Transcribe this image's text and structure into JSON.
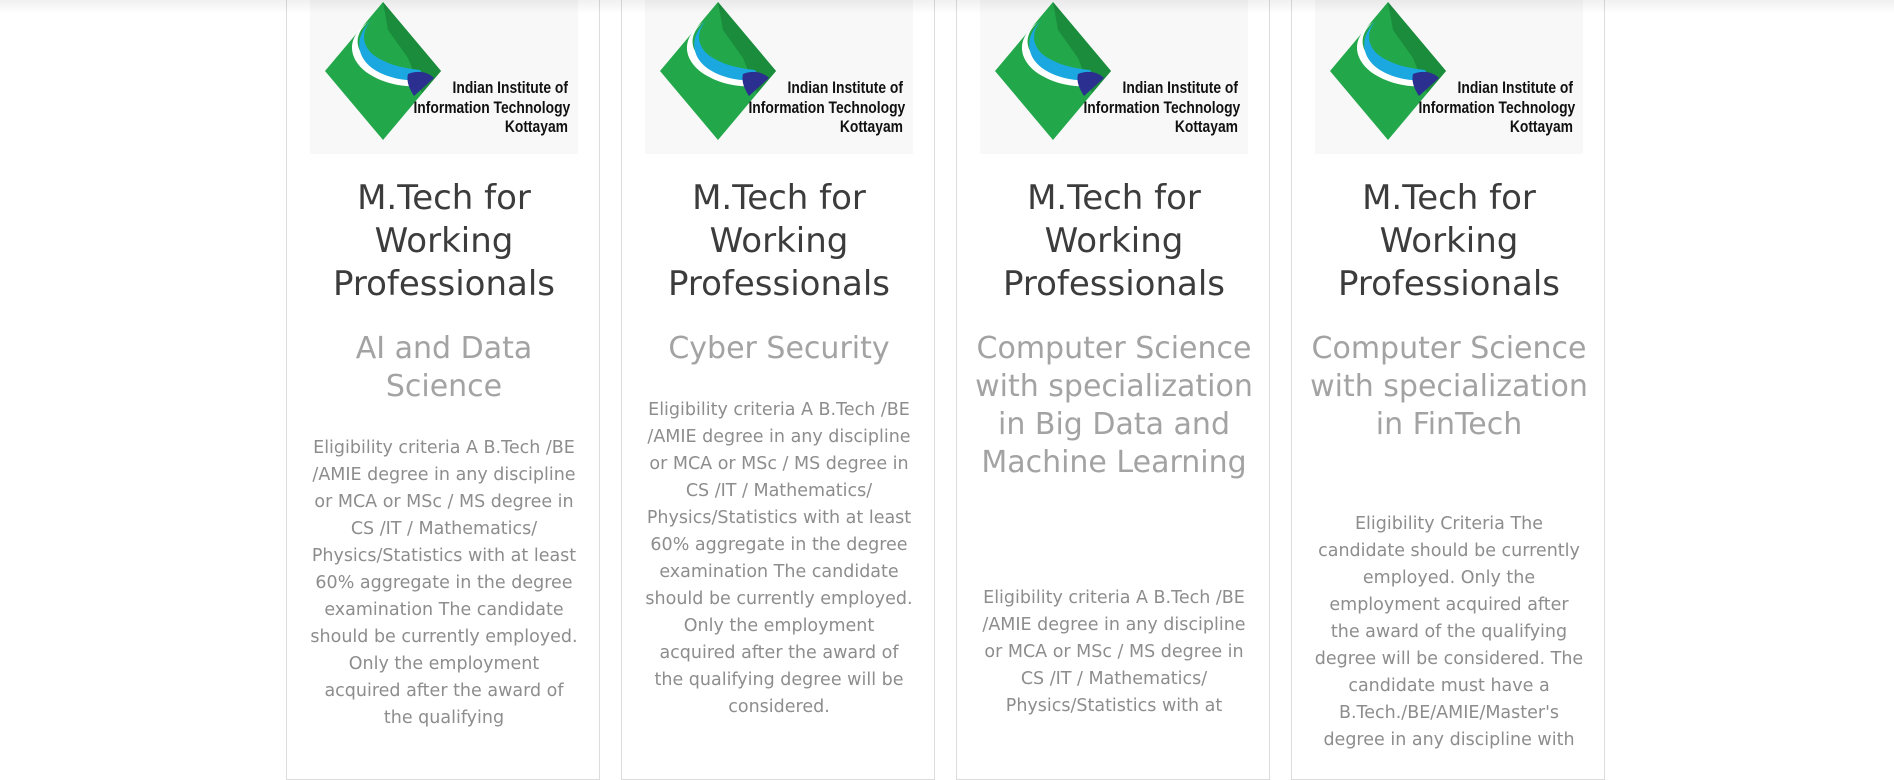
{
  "colors": {
    "logo_green": "#22a84a",
    "logo_dark_green": "#1b8b3c",
    "logo_cyan": "#1ba8e0",
    "logo_navy": "#2b2f8f",
    "title": "#3c3c3c",
    "subtitle": "#a3a3a3",
    "body_text": "#8d8d8d"
  },
  "cards": [
    {
      "logo": {
        "line1": "Indian Institute of",
        "line2": "Information Technology",
        "line3": "Kottayam"
      },
      "title": "M.Tech for Working Professionals",
      "specialization": "AI and Data Science",
      "description": "Eligibility criteria A B.Tech /BE /AMIE degree in any discipline or MCA or MSc / MS degree in CS /IT / Mathematics/ Physics/Statistics with at least 60% aggregate in the degree examination The candidate should be currently employed. Only the employment acquired after the award of the qualifying"
    },
    {
      "logo": {
        "line1": "Indian Institute of",
        "line2": "Information Technology",
        "line3": "Kottayam"
      },
      "title": "M.Tech for Working Professionals",
      "specialization": "Cyber Security",
      "description": "Eligibility criteria A B.Tech /BE /AMIE degree in any discipline or MCA or MSc / MS degree in CS /IT / Mathematics/ Physics/Statistics with at least 60% aggregate in the degree examination The candidate should be currently employed. Only the employment acquired after the award of the qualifying degree will be considered."
    },
    {
      "logo": {
        "line1": "Indian Institute of",
        "line2": "Information Technology",
        "line3": "Kottayam"
      },
      "title": "M.Tech for Working Professionals",
      "specialization": "Computer Science with specialization in Big Data and Machine Learning",
      "description": "Eligibility criteria A B.Tech /BE /AMIE degree in any discipline or MCA or MSc / MS degree in CS /IT / Mathematics/ Physics/Statistics with at"
    },
    {
      "logo": {
        "line1": "Indian Institute of",
        "line2": "Information Technology",
        "line3": "Kottayam"
      },
      "title": "M.Tech for Working Professionals",
      "specialization": "Computer Science with specialization in FinTech",
      "description": "Eligibility Criteria The candidate should be currently employed. Only the employment acquired after the award of the qualifying degree will be considered. The candidate must have a B.Tech./BE/AMIE/Master's degree in any discipline with"
    }
  ]
}
